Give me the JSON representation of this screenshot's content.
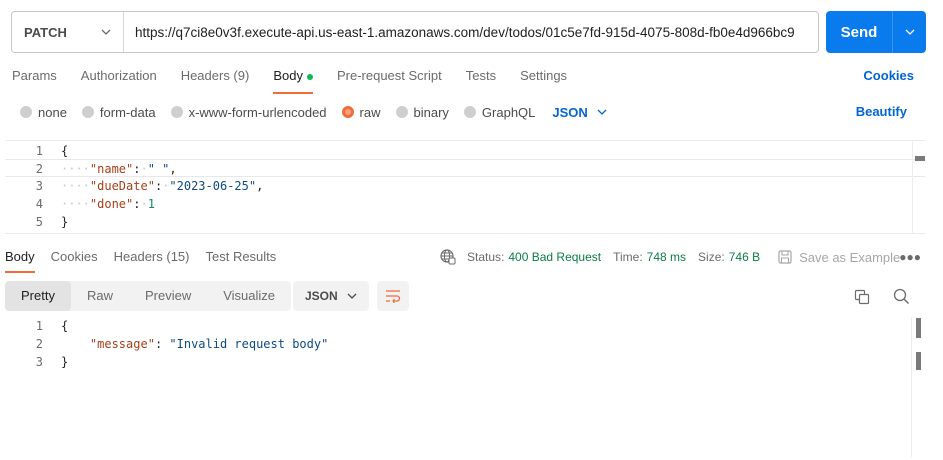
{
  "request": {
    "method": "PATCH",
    "url": "https://q7ci8e0v3f.execute-api.us-east-1.amazonaws.com/dev/todos/01c5e7fd-915d-4075-808d-fb0e4d966bc9",
    "send_label": "Send"
  },
  "request_tabs": {
    "params": "Params",
    "authorization": "Authorization",
    "headers": "Headers (9)",
    "body": "Body",
    "prerequest": "Pre-request Script",
    "tests": "Tests",
    "settings": "Settings",
    "cookies": "Cookies"
  },
  "body_options": {
    "none": "none",
    "form_data": "form-data",
    "urlencoded": "x-www-form-urlencoded",
    "raw": "raw",
    "binary": "binary",
    "graphql": "GraphQL",
    "format": "JSON",
    "beautify": "Beautify"
  },
  "request_body": {
    "ln1": "1",
    "ln2": "2",
    "ln3": "3",
    "ln4": "4",
    "ln5": "5",
    "open": "{",
    "close": "}",
    "k_name": "\"name\"",
    "v_name": "\" \"",
    "k_due": "\"dueDate\"",
    "v_due": "\"2023-06-25\"",
    "k_done": "\"done\"",
    "v_done": "1"
  },
  "response_tabs": {
    "body": "Body",
    "cookies": "Cookies",
    "headers": "Headers (15)",
    "test_results": "Test Results"
  },
  "response_meta": {
    "status_label": "Status:",
    "status_value": "400 Bad Request",
    "time_label": "Time:",
    "time_value": "748 ms",
    "size_label": "Size:",
    "size_value": "746 B",
    "save_example": "Save as Example"
  },
  "view_tabs": {
    "pretty": "Pretty",
    "raw": "Raw",
    "preview": "Preview",
    "visualize": "Visualize",
    "format": "JSON"
  },
  "response_body": {
    "ln1": "1",
    "ln2": "2",
    "ln3": "3",
    "open": "{",
    "close": "}",
    "k_message": "\"message\"",
    "v_message": "\"Invalid request body\""
  },
  "colors": {
    "accent_orange": "#f26b3a",
    "send_blue": "#097bed",
    "link_blue": "#0265d2",
    "status_green": "#0a7d43"
  }
}
